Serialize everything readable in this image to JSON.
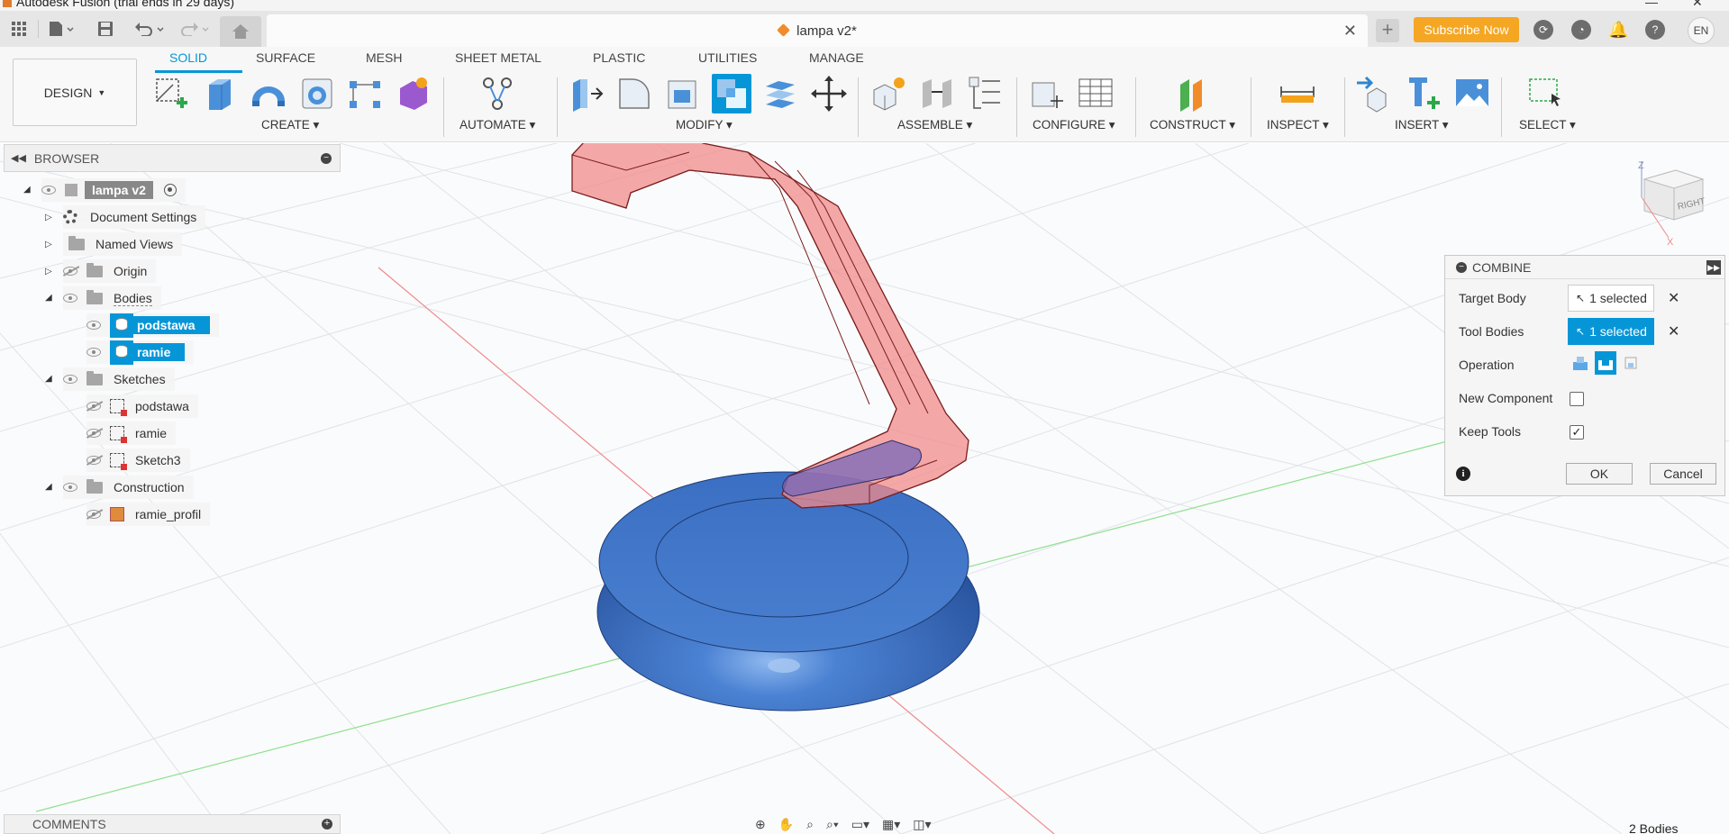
{
  "window": {
    "title": "Autodesk Fusion (trial ends in 29 days)"
  },
  "topbar": {
    "document_title": "lampa v2*",
    "subscribe_label": "Subscribe Now",
    "language": "EN"
  },
  "ribbon": {
    "workspace": "DESIGN",
    "tabs": [
      "SOLID",
      "SURFACE",
      "MESH",
      "SHEET METAL",
      "PLASTIC",
      "UTILITIES",
      "MANAGE"
    ],
    "active_tab": "SOLID",
    "groups": {
      "create": "CREATE",
      "automate": "AUTOMATE",
      "modify": "MODIFY",
      "assemble": "ASSEMBLE",
      "configure": "CONFIGURE",
      "construct": "CONSTRUCT",
      "inspect": "INSPECT",
      "insert": "INSERT",
      "select": "SELECT"
    },
    "colors": {
      "accent": "#0696d7",
      "subscribe": "#f5a623"
    }
  },
  "browser": {
    "title": "BROWSER",
    "root": "lampa v2",
    "items": {
      "document_settings": "Document Settings",
      "named_views": "Named Views",
      "origin": "Origin",
      "bodies": "Bodies",
      "body1": "podstawa",
      "body2": "ramie",
      "sketches": "Sketches",
      "sketch1": "podstawa",
      "sketch2": "ramie",
      "sketch3": "Sketch3",
      "construction": "Construction",
      "construction1": "ramie_profil"
    }
  },
  "combine": {
    "title": "COMBINE",
    "target_body_label": "Target Body",
    "target_body_value": "1 selected",
    "tool_bodies_label": "Tool Bodies",
    "tool_bodies_value": "1 selected",
    "operation_label": "Operation",
    "operation_selected": "cut",
    "new_component_label": "New Component",
    "new_component_checked": false,
    "keep_tools_label": "Keep Tools",
    "keep_tools_checked": true,
    "ok": "OK",
    "cancel": "Cancel"
  },
  "viewcube": {
    "face": "RIGHT",
    "axis_z": "Z",
    "axis_x": "X"
  },
  "comments": {
    "title": "COMMENTS"
  },
  "status": {
    "bodies": "2 Bodies"
  },
  "model_colors": {
    "base": "#3b6fc3",
    "arm": "#f28b8b",
    "arm_edge": "#c33"
  }
}
